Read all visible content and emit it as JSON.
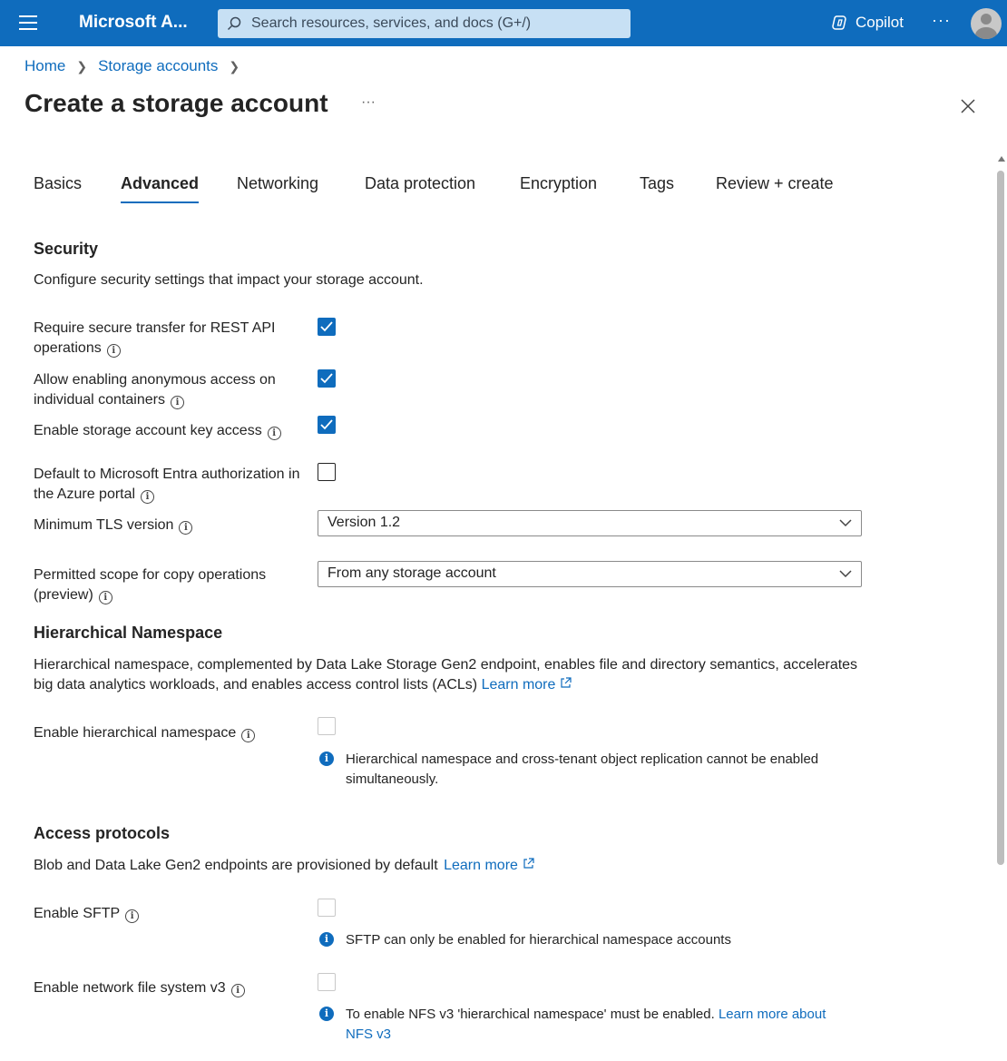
{
  "topbar": {
    "brand": "Microsoft A...",
    "search_placeholder": "Search resources, services, and docs (G+/)",
    "copilot_label": "Copilot",
    "more_label": "···"
  },
  "breadcrumb": {
    "home": "Home",
    "storage_accounts": "Storage accounts"
  },
  "page": {
    "title": "Create a storage account",
    "more": "···"
  },
  "tabs": [
    {
      "label": "Basics",
      "active": false
    },
    {
      "label": "Advanced",
      "active": true
    },
    {
      "label": "Networking",
      "active": false
    },
    {
      "label": "Data protection",
      "active": false
    },
    {
      "label": "Encryption",
      "active": false
    },
    {
      "label": "Tags",
      "active": false
    },
    {
      "label": "Review + create",
      "active": false
    }
  ],
  "security": {
    "heading": "Security",
    "description": "Configure security settings that impact your storage account.",
    "secure_transfer": {
      "label": "Require secure transfer for REST API operations",
      "checked": true
    },
    "anonymous_access": {
      "label": "Allow enabling anonymous access on individual containers",
      "checked": true
    },
    "key_access": {
      "label": "Enable storage account key access",
      "checked": true
    },
    "entra_default": {
      "label": "Default to Microsoft Entra authorization in the Azure portal",
      "checked": false
    },
    "tls": {
      "label": "Minimum TLS version",
      "value": "Version 1.2"
    },
    "copy_scope": {
      "label": "Permitted scope for copy operations (preview)",
      "value": "From any storage account"
    }
  },
  "hns": {
    "heading": "Hierarchical Namespace",
    "description": "Hierarchical namespace, complemented by Data Lake Storage Gen2 endpoint, enables file and directory semantics, accelerates big data analytics workloads, and enables access control lists (ACLs)",
    "learn_more": "Learn more",
    "enable_label": "Enable hierarchical namespace",
    "enabled": false,
    "note": "Hierarchical namespace and cross-tenant object replication cannot be enabled simultaneously."
  },
  "protocols": {
    "heading": "Access protocols",
    "description": "Blob and Data Lake Gen2 endpoints are provisioned by default",
    "learn_more": "Learn more",
    "sftp_label": "Enable SFTP",
    "sftp_enabled": false,
    "sftp_note": "SFTP can only be enabled for hierarchical namespace accounts",
    "nfs_label": "Enable network file system v3",
    "nfs_enabled": false,
    "nfs_note": "To enable NFS v3 'hierarchical namespace' must be enabled.",
    "nfs_learn_more": "Learn more about NFS v3"
  },
  "icons": {
    "info_glyph": "i",
    "colors": {
      "accent": "#0f6cbd",
      "topbar": "#0f6cbd",
      "search_bg": "#c7e0f4"
    }
  }
}
